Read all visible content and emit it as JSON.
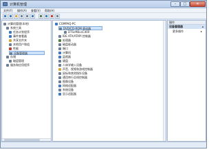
{
  "window": {
    "title": "计算机管理"
  },
  "menubar": [
    "文件(F)",
    "操作(A)",
    "查看(V)",
    "帮助(H)"
  ],
  "toolbar": {
    "buttons": [
      {
        "name": "back-icon",
        "color": "#3a78c9"
      },
      {
        "name": "forward-icon",
        "color": "#3a78c9"
      },
      {
        "name": "up-folder-icon",
        "color": "#d9a63a"
      },
      {
        "name": "show-tree-icon",
        "color": "#6b7f99"
      },
      {
        "name": "properties-icon",
        "color": "#6b7f99"
      },
      {
        "name": "help-icon",
        "color": "#3a78c9"
      },
      {
        "name": "scan-hardware-icon",
        "color": "#4f7f3f"
      },
      {
        "name": "update-driver-icon",
        "color": "#3a78c9"
      },
      {
        "name": "uninstall-icon",
        "color": "#c23b2b"
      },
      {
        "name": "disable-icon",
        "color": "#6b7f99"
      }
    ]
  },
  "tree": {
    "root": "计算机管理(本地)",
    "items": [
      {
        "label": "系统工具",
        "color": "#6b7f99"
      },
      {
        "label": "任务计划程序",
        "color": "#3a78c9"
      },
      {
        "label": "事件查看器",
        "color": "#3a78c9"
      },
      {
        "label": "共享文件夹",
        "color": "#d9a63a"
      },
      {
        "label": "本地用户和组",
        "color": "#6b7f99"
      },
      {
        "label": "性能",
        "color": "#c23b2b"
      },
      {
        "label": "设备管理器",
        "color": "#6b7f99",
        "selected": true
      },
      {
        "label": "存储",
        "color": "#6b7f99"
      },
      {
        "label": "磁盘管理",
        "color": "#6b7f99"
      },
      {
        "label": "服务和应用程序",
        "color": "#6b7f99"
      }
    ]
  },
  "devices": {
    "computer": "COMPAQ-PC",
    "items": [
      {
        "label": "DVD/CD-ROM 驱动器",
        "color": "#6b7f99",
        "selected": true
      },
      {
        "label": "DTSoftBusCd00",
        "color": "#6b7f99",
        "child": true
      },
      {
        "label": "IDE ATA/ATAPI 控制器",
        "color": "#6b7f99"
      },
      {
        "label": "处理器",
        "color": "#4f7f3f"
      },
      {
        "label": "磁盘驱动器",
        "color": "#6b7f99"
      },
      {
        "label": "端口",
        "color": "#6b7f99"
      },
      {
        "label": "计算机",
        "color": "#3a78c9"
      },
      {
        "label": "监视器",
        "color": "#3a78c9"
      },
      {
        "label": "键盘",
        "color": "#6b7f99"
      },
      {
        "label": "人体学输入设备",
        "color": "#6b7f99"
      },
      {
        "label": "声音、视频和游戏控制器",
        "color": "#d9a63a"
      },
      {
        "label": "鼠标和其他指针设备",
        "color": "#6b7f99"
      },
      {
        "label": "通用串行总线控制器",
        "color": "#6b7f99"
      },
      {
        "label": "图像设备",
        "color": "#6b7f99"
      },
      {
        "label": "网络适配器",
        "color": "#3a78c9"
      },
      {
        "label": "系统设备",
        "color": "#6b7f99"
      },
      {
        "label": "显示适配器",
        "color": "#3a78c9"
      }
    ]
  },
  "actions": {
    "header": "操作",
    "section": "设备管理器",
    "more": "更多操作"
  }
}
